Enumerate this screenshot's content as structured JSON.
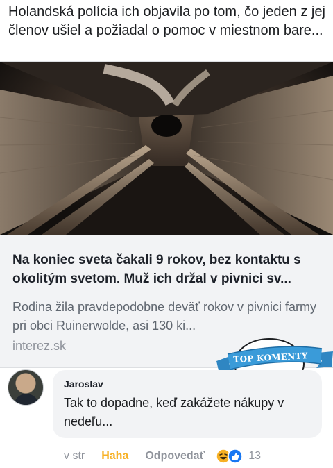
{
  "post": {
    "text": "Holandská polícia ich objavila po tom, čo jeden z jej členov ušiel a požiadal o pomoc v miestnom bare..."
  },
  "link": {
    "title": "Na koniec sveta čakali 9 rokov, bez kontaktu s okolitým svetom. Muž ich držal v pivnici sv...",
    "description": "Rodina žila pravdepodobne deväť rokov v pivnici farmy pri obci Ruinerwolde, asi 130 ki...",
    "domain": "interez.sk"
  },
  "badge": {
    "label": "TOP KOMENTY"
  },
  "comment": {
    "author": "Jaroslav",
    "text": "Tak to dopadne, keď zakážete nákupy v nedeľu...",
    "time": "v str",
    "reaction_label": "Haha",
    "reply_label": "Odpovedať",
    "reaction_count": "13",
    "reaction_icons": [
      "haha-emoji-icon",
      "like-thumb-icon"
    ]
  },
  "colors": {
    "haha": "#f7b125",
    "like": "#1877f2",
    "badge_ribbon": "#3a9bd9"
  }
}
